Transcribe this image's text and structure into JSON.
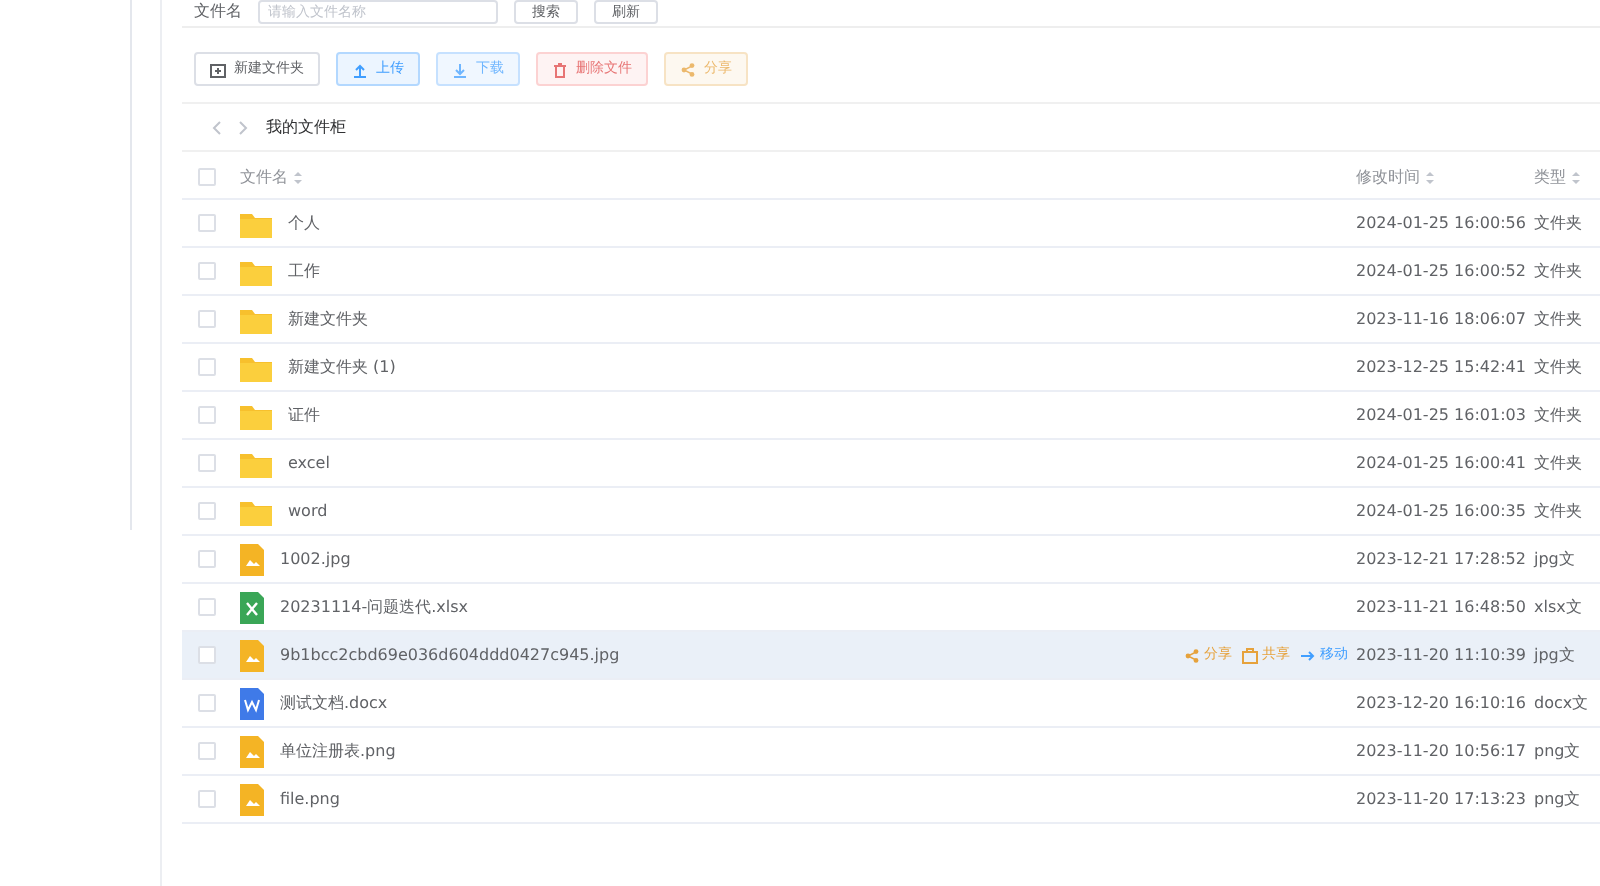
{
  "search": {
    "label": "文件名",
    "placeholder": "请输入文件名称",
    "buttons": [
      "搜索",
      "刷新"
    ]
  },
  "toolbar": [
    {
      "label": "新建文件夹",
      "kind": "new",
      "disabled": false
    },
    {
      "label": "上传",
      "kind": "upload",
      "disabled": false
    },
    {
      "label": "下载",
      "kind": "download",
      "disabled": true
    },
    {
      "label": "删除文件",
      "kind": "delete",
      "disabled": true
    },
    {
      "label": "分享",
      "kind": "share",
      "disabled": true
    }
  ],
  "breadcrumb": {
    "path": "我的文件柜"
  },
  "table": {
    "select_all_checked": false,
    "columns": [
      "文件名",
      "修改时间",
      "类型"
    ],
    "rows": [
      {
        "name": "个人",
        "kind": "folder",
        "modified": "2024-01-25 16:00:56",
        "type": "文件夹",
        "checked": false,
        "hovered": false
      },
      {
        "name": "工作",
        "kind": "folder",
        "modified": "2024-01-25 16:00:52",
        "type": "文件夹",
        "checked": false,
        "hovered": false
      },
      {
        "name": "新建文件夹",
        "kind": "folder",
        "modified": "2023-11-16 18:06:07",
        "type": "文件夹",
        "checked": false,
        "hovered": false
      },
      {
        "name": "新建文件夹 (1)",
        "kind": "folder",
        "modified": "2023-12-25 15:42:41",
        "type": "文件夹",
        "checked": false,
        "hovered": false
      },
      {
        "name": "证件",
        "kind": "folder",
        "modified": "2024-01-25 16:01:03",
        "type": "文件夹",
        "checked": false,
        "hovered": false
      },
      {
        "name": "excel",
        "kind": "folder",
        "modified": "2024-01-25 16:00:41",
        "type": "文件夹",
        "checked": false,
        "hovered": false
      },
      {
        "name": "word",
        "kind": "folder",
        "modified": "2024-01-25 16:00:35",
        "type": "文件夹",
        "checked": false,
        "hovered": false
      },
      {
        "name": "1002.jpg",
        "kind": "image",
        "modified": "2023-12-21 17:28:52",
        "type": "jpg文",
        "checked": false,
        "hovered": false
      },
      {
        "name": "20231114-问题迭代.xlsx",
        "kind": "excel",
        "modified": "2023-11-21 16:48:50",
        "type": "xlsx文",
        "checked": false,
        "hovered": false
      },
      {
        "name": "9b1bcc2cbd69e036d604ddd0427c945.jpg",
        "kind": "image",
        "modified": "2023-11-20 11:10:39",
        "type": "jpg文",
        "checked": false,
        "hovered": true,
        "actions": [
          "分享",
          "共享",
          "移动"
        ]
      },
      {
        "name": "测试文档.docx",
        "kind": "word",
        "modified": "2023-12-20 16:10:16",
        "type": "docx文",
        "checked": false,
        "hovered": false
      },
      {
        "name": "单位注册表.png",
        "kind": "image",
        "modified": "2023-11-20 10:56:17",
        "type": "png文",
        "checked": false,
        "hovered": false
      },
      {
        "name": "file.png",
        "kind": "image",
        "modified": "2023-11-20 17:13:23",
        "type": "png文",
        "checked": false,
        "hovered": false
      }
    ]
  }
}
